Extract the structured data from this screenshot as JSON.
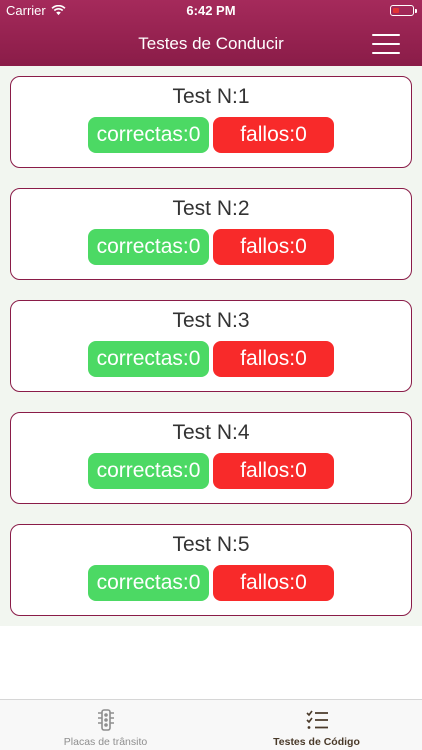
{
  "status_bar": {
    "carrier": "Carrier",
    "time": "6:42 PM"
  },
  "header": {
    "title": "Testes de Conducir",
    "menu_icon": "hamburger-menu-icon"
  },
  "tests": [
    {
      "title": "Test N:1",
      "correct_label": "correctas:0",
      "fail_label": "fallos:0"
    },
    {
      "title": "Test N:2",
      "correct_label": "correctas:0",
      "fail_label": "fallos:0"
    },
    {
      "title": "Test N:3",
      "correct_label": "correctas:0",
      "fail_label": "fallos:0"
    },
    {
      "title": "Test N:4",
      "correct_label": "correctas:0",
      "fail_label": "fallos:0"
    },
    {
      "title": "Test N:5",
      "correct_label": "correctas:0",
      "fail_label": "fallos:0"
    }
  ],
  "tabbar": {
    "tabs": [
      {
        "label": "Placas de trânsito",
        "icon": "traffic-light-icon",
        "active": false
      },
      {
        "label": "Testes de Código",
        "icon": "checklist-icon",
        "active": true
      }
    ]
  },
  "colors": {
    "header": "#8a1c48",
    "card_border": "#8a1c48",
    "correct": "#4cd964",
    "fail": "#f82a2a",
    "content_bg": "#f2f6f0"
  }
}
